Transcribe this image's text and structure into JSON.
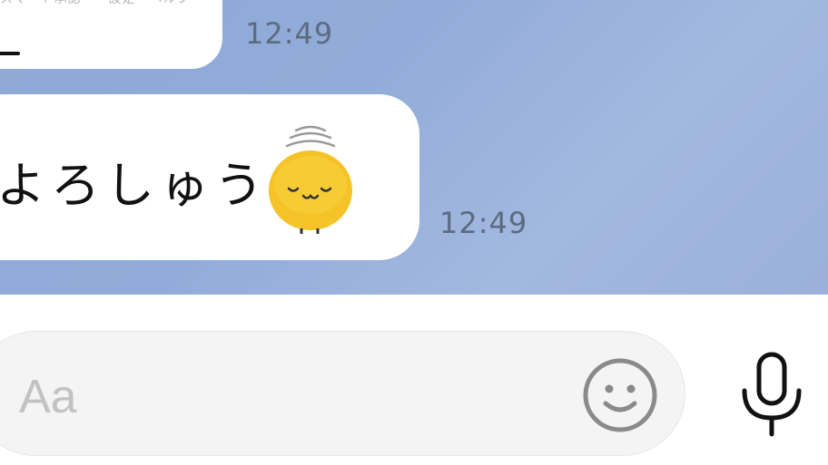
{
  "chat": {
    "messages": [
      {
        "sender": "self",
        "faint_text": "スマート承認　　設定・ヘルプ",
        "time": "12:49"
      },
      {
        "sender": "self",
        "text": "よろしゅう",
        "sticker": "bowing-yellow-bird-sticker",
        "time": "12:49"
      }
    ],
    "background_color": "#92acd9",
    "bubble_color": "#ffffff",
    "timestamp_color": "#5c6b82"
  },
  "input_bar": {
    "placeholder": "Aa",
    "emoji_icon": "smiley-icon",
    "mic_icon": "microphone-icon"
  }
}
